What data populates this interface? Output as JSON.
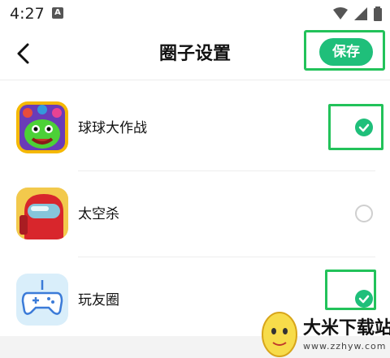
{
  "status_bar": {
    "time": "4:27",
    "badge": "A"
  },
  "header": {
    "title": "圈子设置",
    "save_label": "保存"
  },
  "apps": [
    {
      "name": "球球大作战",
      "checked": true
    },
    {
      "name": "太空杀",
      "checked": false
    },
    {
      "name": "玩友圈",
      "checked": true
    }
  ],
  "watermark": {
    "title": "大米下载站",
    "url": "www.zzhyw.com"
  },
  "colors": {
    "accent": "#1fbf7a",
    "highlight": "#22c25a"
  }
}
